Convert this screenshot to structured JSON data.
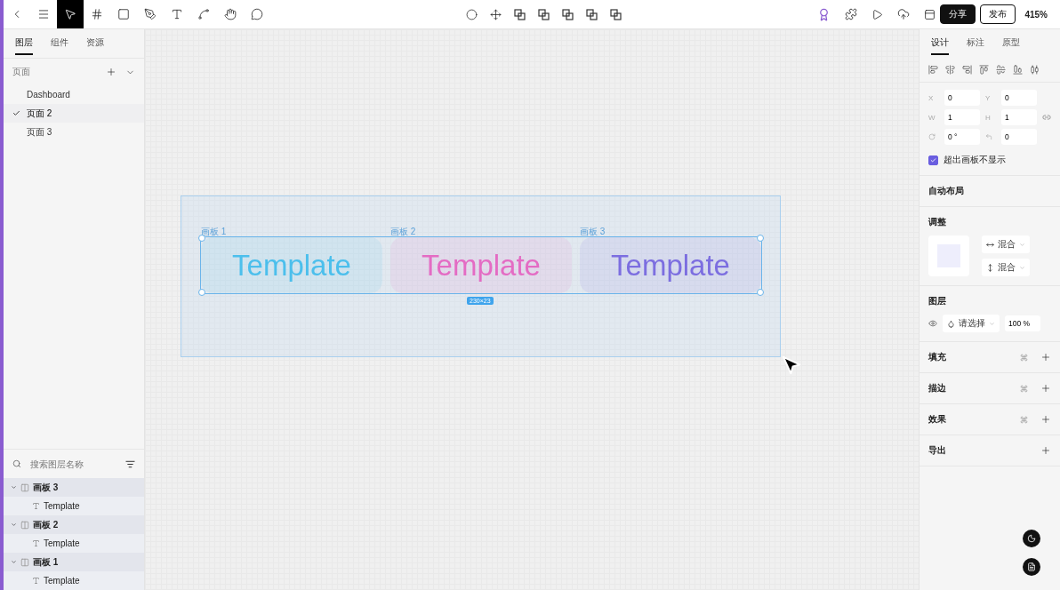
{
  "toolbar": {
    "tools": [
      {
        "selected": false
      },
      {
        "selected": false
      },
      {
        "selected": true
      },
      {
        "selected": false
      },
      {
        "selected": false
      },
      {
        "selected": false
      },
      {
        "selected": false
      },
      {
        "selected": false
      },
      {
        "selected": false
      },
      {
        "selected": false
      }
    ],
    "share_button": "分享",
    "publish_button": "发布",
    "zoom": "415%"
  },
  "left_panel": {
    "tabs": [
      {
        "label": "图层",
        "selected": true
      },
      {
        "label": "组件",
        "selected": false
      },
      {
        "label": "资源",
        "selected": false
      }
    ],
    "pages_title": "页面",
    "pages": [
      {
        "label": "Dashboard",
        "selected": false
      },
      {
        "label": "页面 2",
        "selected": true
      },
      {
        "label": "页面 3",
        "selected": false
      }
    ],
    "search": {
      "placeholder": "搜索图层名称"
    },
    "layers": [
      {
        "name": "画板 3",
        "expanded": true,
        "children": [
          {
            "name": "Template"
          }
        ]
      },
      {
        "name": "画板 2",
        "expanded": true,
        "children": [
          {
            "name": "Template"
          }
        ]
      },
      {
        "name": "画板 1",
        "expanded": true,
        "children": [
          {
            "name": "Template"
          }
        ]
      }
    ]
  },
  "canvas": {
    "frames": [
      {
        "label": "画板 1",
        "text": "Template",
        "color": "#4cbfec"
      },
      {
        "label": "画板 2",
        "text": "Template",
        "color": "#e46cc4"
      },
      {
        "label": "画板 3",
        "text": "Template",
        "color": "#7c6ee0"
      }
    ],
    "size_badge": "230×23"
  },
  "right_panel": {
    "tabs": [
      {
        "label": "设计",
        "selected": true
      },
      {
        "label": "标注",
        "selected": false
      },
      {
        "label": "原型",
        "selected": false
      }
    ],
    "fields": [
      {
        "label": "X",
        "value": "0"
      },
      {
        "label": "Y",
        "value": "0"
      },
      {
        "label": "W",
        "value": "1"
      },
      {
        "label": "H",
        "value": "1"
      },
      {
        "value": "0 °"
      },
      {
        "value": "0"
      }
    ],
    "clip_checkbox": {
      "label": "超出画板不显示",
      "checked": true
    },
    "auto_layout": "自动布局",
    "adjust": {
      "title": "调整",
      "horizontal": "混合",
      "vertical": "混合"
    },
    "layer": {
      "title": "图层",
      "blend": "请选择",
      "opacity": "100 %"
    },
    "sections": [
      {
        "title": "填充",
        "styles": true
      },
      {
        "title": "描边",
        "styles": true
      },
      {
        "title": "效果",
        "styles": true
      },
      {
        "title": "导出",
        "styles": false
      }
    ]
  }
}
